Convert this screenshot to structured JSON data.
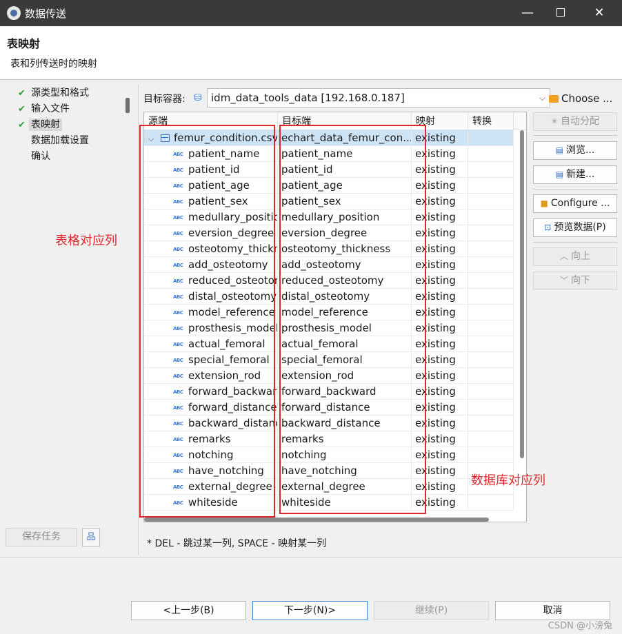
{
  "window": {
    "title": "数据传送"
  },
  "header": {
    "title": "表映射",
    "subtitle": "表和列传送时的映射"
  },
  "steps": [
    {
      "label": "源类型和格式",
      "done": true
    },
    {
      "label": "输入文件",
      "done": true
    },
    {
      "label": "表映射",
      "done": true,
      "active": true
    },
    {
      "label": "数据加载设置",
      "done": false
    },
    {
      "label": "确认",
      "done": false
    }
  ],
  "save_task_label": "保存任务",
  "target": {
    "label": "目标容器:",
    "value": "idm_data_tools_data  [192.168.0.187]",
    "choose_label": "Choose ..."
  },
  "table": {
    "columns": [
      "源端",
      "目标端",
      "映射",
      "转换"
    ],
    "parent": {
      "source": "femur_condition.csv",
      "target": "echart_data_femur_con...",
      "mapping": "existing"
    },
    "rows": [
      {
        "source": "patient_name",
        "target": "patient_name",
        "mapping": "existing"
      },
      {
        "source": "patient_id",
        "target": "patient_id",
        "mapping": "existing"
      },
      {
        "source": "patient_age",
        "target": "patient_age",
        "mapping": "existing"
      },
      {
        "source": "patient_sex",
        "target": "patient_sex",
        "mapping": "existing"
      },
      {
        "source": "medullary_positio",
        "target": "medullary_position",
        "mapping": "existing"
      },
      {
        "source": "eversion_degree",
        "target": "eversion_degree",
        "mapping": "existing"
      },
      {
        "source": "osteotomy_thickn",
        "target": "osteotomy_thickness",
        "mapping": "existing"
      },
      {
        "source": "add_osteotomy",
        "target": "add_osteotomy",
        "mapping": "existing"
      },
      {
        "source": "reduced_osteoton",
        "target": "reduced_osteotomy",
        "mapping": "existing"
      },
      {
        "source": "distal_osteotomy",
        "target": "distal_osteotomy",
        "mapping": "existing"
      },
      {
        "source": "model_reference",
        "target": "model_reference",
        "mapping": "existing"
      },
      {
        "source": "prosthesis_model",
        "target": "prosthesis_model",
        "mapping": "existing"
      },
      {
        "source": "actual_femoral",
        "target": "actual_femoral",
        "mapping": "existing"
      },
      {
        "source": "special_femoral",
        "target": "special_femoral",
        "mapping": "existing"
      },
      {
        "source": "extension_rod",
        "target": "extension_rod",
        "mapping": "existing"
      },
      {
        "source": "forward_backward",
        "target": "forward_backward",
        "mapping": "existing"
      },
      {
        "source": "forward_distance",
        "target": "forward_distance",
        "mapping": "existing"
      },
      {
        "source": "backward_distanc",
        "target": "backward_distance",
        "mapping": "existing"
      },
      {
        "source": "remarks",
        "target": "remarks",
        "mapping": "existing"
      },
      {
        "source": "notching",
        "target": "notching",
        "mapping": "existing"
      },
      {
        "source": "have_notching",
        "target": "have_notching",
        "mapping": "existing"
      },
      {
        "source": "external_degree",
        "target": "external_degree",
        "mapping": "existing"
      },
      {
        "source": "whiteside",
        "target": "whiteside",
        "mapping": "existing"
      }
    ]
  },
  "annotations": {
    "source_col": "表格对应列",
    "target_col": "数据库对应列"
  },
  "side_buttons": {
    "auto_assign": "自动分配",
    "browse": "浏览...",
    "new": "新建...",
    "configure": "Configure ...",
    "preview": "预览数据(P)",
    "up": "向上",
    "down": "向下"
  },
  "hint": "* DEL - 跳过某一列, SPACE - 映射某一列",
  "footer": {
    "back": "<上一步(B)",
    "next": "下一步(N)>",
    "continue": "继续(P)",
    "cancel": "取消"
  },
  "watermark": "CSDN @小滂兔",
  "colors": {
    "accent": "#2b6fc9",
    "annotation_red": "#e0262d",
    "check_green": "#2e9e3e",
    "selection": "#cde4f7"
  }
}
